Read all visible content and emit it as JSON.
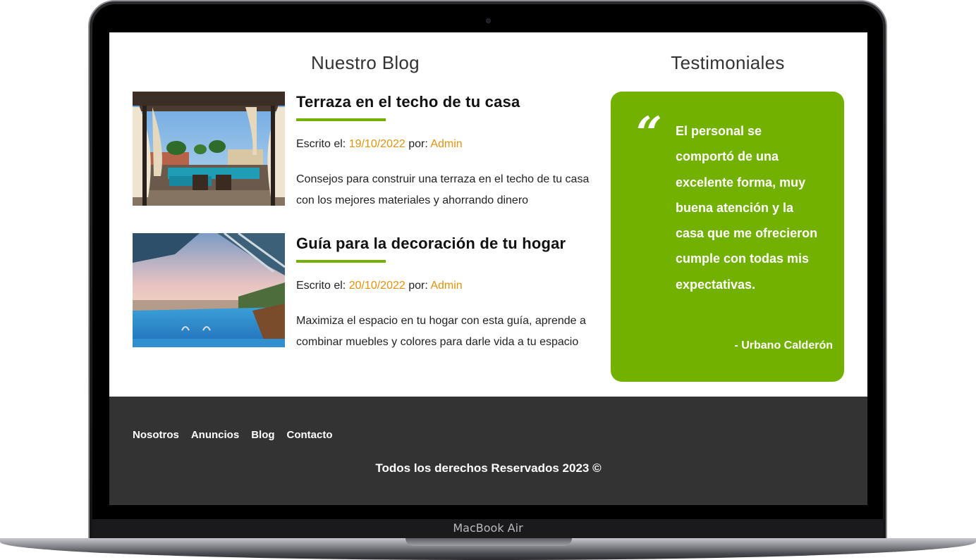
{
  "device": {
    "label": "MacBook Air"
  },
  "blog": {
    "heading": "Nuestro Blog",
    "posts": [
      {
        "title": "Terraza en el techo de tu casa",
        "meta_prefix": "Escrito el: ",
        "date": "19/10/2022",
        "author_prefix": " por: ",
        "author": "Admin",
        "excerpt": "Consejos para construir una terraza en el techo de tu casa con los mejores materiales y ahorrando dinero",
        "image": "rooftop-terrace-photo"
      },
      {
        "title": "Guía para la decoración de tu hogar",
        "meta_prefix": "Escrito el: ",
        "date": "20/10/2022",
        "author_prefix": " por: ",
        "author": "Admin",
        "excerpt": "Maximiza el espacio en tu hogar con esta guía, aprende a combinar muebles y colores para darle vida a tu espacio",
        "image": "infinity-pool-photo"
      }
    ]
  },
  "testimonials": {
    "heading": "Testimoniales",
    "quote_icon": "quote-icon",
    "quote": "El personal se comportó de una excelente forma, muy buena atención y la casa que me ofrecieron cumple con todas mis expectativas.",
    "author": "- Urbano Calderón"
  },
  "footer": {
    "nav": [
      "Nosotros",
      "Anuncios",
      "Blog",
      "Contacto"
    ],
    "copyright": "Todos los derechos Reservados 2023 ©"
  },
  "colors": {
    "accent_green": "#72b100",
    "accent_orange": "#e6920a",
    "footer_bg": "#333333"
  }
}
